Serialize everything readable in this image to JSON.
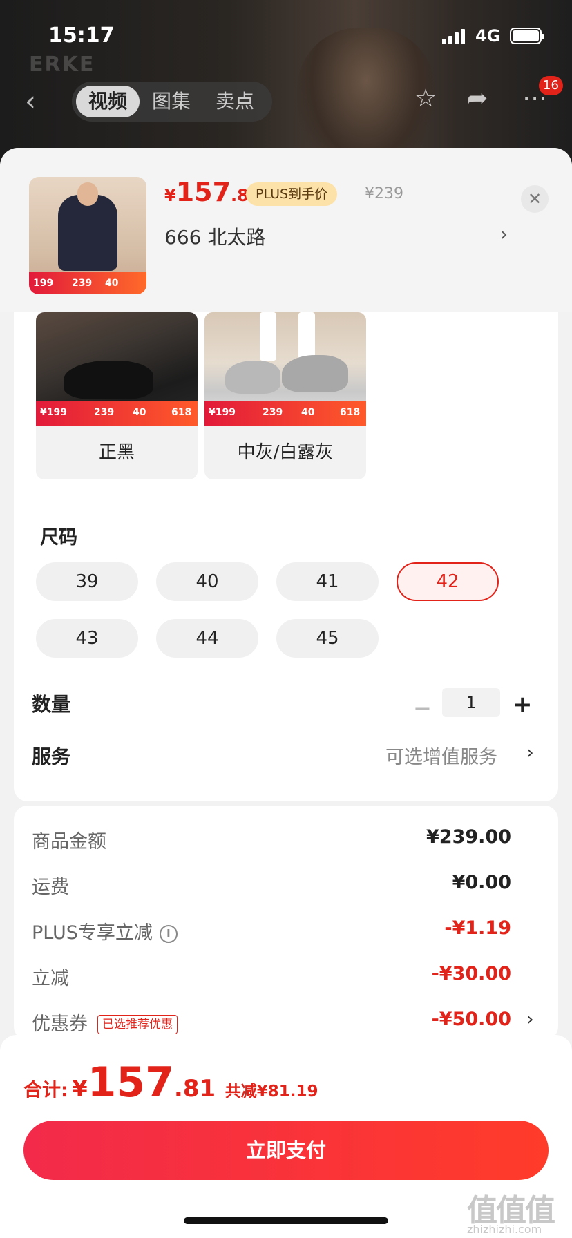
{
  "status_bar": {
    "time": "15:17",
    "network": "4G"
  },
  "nav": {
    "tabs": [
      "视频",
      "图集",
      "卖点"
    ],
    "active_tab": "视频",
    "badge_count": "16",
    "background_logo": "ERKE"
  },
  "product": {
    "price_currency": "¥",
    "price_int": "157",
    "price_dec": ".81",
    "plus_label": "PLUS到手价",
    "original_price": "¥239",
    "address": "666  北太路",
    "thumb_promo": {
      "tag": "199",
      "price": "239",
      "discount": "40"
    }
  },
  "colors": [
    {
      "name": "正黑",
      "promo_tag": "¥199",
      "promo_price": "239",
      "promo_discount": "40",
      "promo_event": "618"
    },
    {
      "name": "中灰/白露灰",
      "promo_tag": "¥199",
      "promo_price": "239",
      "promo_discount": "40",
      "promo_event": "618"
    }
  ],
  "size": {
    "title": "尺码",
    "options": [
      "39",
      "40",
      "41",
      "42",
      "43",
      "44",
      "45"
    ],
    "selected": "42"
  },
  "quantity": {
    "label": "数量",
    "value": "1",
    "minus": "−",
    "plus": "+"
  },
  "service": {
    "label": "服务",
    "value": "可选增值服务"
  },
  "breakdown": {
    "goods_label": "商品金额",
    "goods_value": "¥239.00",
    "shipping_label": "运费",
    "shipping_value": "¥0.00",
    "plus_label": "PLUS专享立减",
    "plus_value": "-¥1.19",
    "instant_label": "立减",
    "instant_value": "-¥30.00",
    "coupon_label": "优惠券",
    "coupon_tag": "已选推荐优惠",
    "coupon_value": "-¥50.00"
  },
  "total": {
    "label": "合计:",
    "currency": "¥",
    "int": "157",
    "dec": ".81",
    "savings": "共减¥81.19"
  },
  "pay_button": "立即支付",
  "watermark": {
    "main": "值值值",
    "sub": "zhizhizhi.com"
  },
  "accent_color": "#e2231a"
}
